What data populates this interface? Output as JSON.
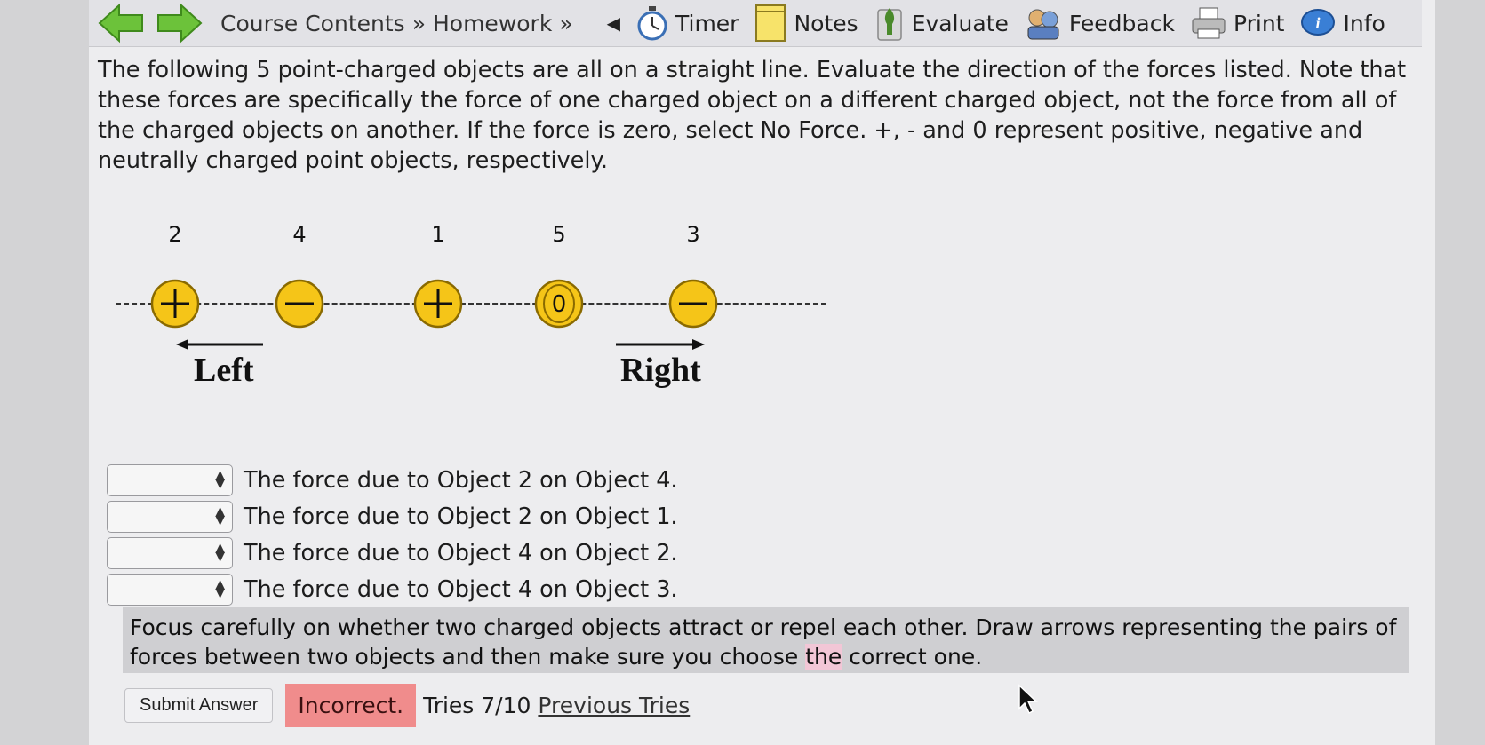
{
  "toolbar": {
    "breadcrumb": [
      "Course Contents",
      "Homework"
    ],
    "tools": [
      {
        "label": "Timer",
        "icon": "stopwatch-icon"
      },
      {
        "label": "Notes",
        "icon": "notepad-icon"
      },
      {
        "label": "Evaluate",
        "icon": "evaluate-icon"
      },
      {
        "label": "Feedback",
        "icon": "feedback-icon"
      },
      {
        "label": "Print",
        "icon": "printer-icon"
      },
      {
        "label": "Info",
        "icon": "info-icon"
      }
    ]
  },
  "question": {
    "text": "The following 5 point-charged objects are all on a straight line. Evaluate the direction of the forces listed. Note that these forces are specifically the force of one charged object on a different charged object, not the force from all of the charged objects on another. If the force is zero, select No Force. +, - and 0 represent positive, negative and neutrally charged point objects, respectively."
  },
  "diagram": {
    "objects": [
      {
        "number": "2",
        "charge": "+"
      },
      {
        "number": "4",
        "charge": "-"
      },
      {
        "number": "1",
        "charge": "+"
      },
      {
        "number": "5",
        "charge": "0"
      },
      {
        "number": "3",
        "charge": "-"
      }
    ],
    "left_label": "Left",
    "right_label": "Right",
    "charge_fill": "#f5c518",
    "charge_stroke": "#8a6a00"
  },
  "rows": [
    {
      "value": "",
      "text": "The force due to Object 2 on Object 4."
    },
    {
      "value": "",
      "text": "The force due to Object 2 on Object 1."
    },
    {
      "value": "",
      "text": "The force due to Object 4 on Object 2."
    },
    {
      "value": "",
      "text": "The force due to Object 4 on Object 3."
    }
  ],
  "hint": {
    "before": "Focus carefully on whether two charged objects attract or repel each other. Draw arrows representing the pairs of forces between two objects and then make sure you choose ",
    "mark": "the",
    "after": " correct one."
  },
  "submit": {
    "button": "Submit Answer",
    "status": "Incorrect.",
    "tries": "Tries 7/10",
    "previous": "Previous Tries"
  }
}
